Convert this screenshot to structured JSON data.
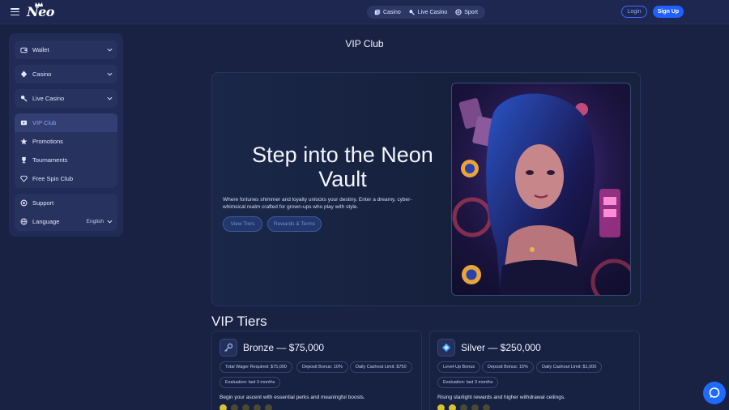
{
  "header": {
    "logo_text": "Neo",
    "nav": [
      {
        "label": "Casino",
        "icon": "casino-icon"
      },
      {
        "label": "Live Casino",
        "icon": "live-casino-icon"
      },
      {
        "label": "Sport",
        "icon": "sport-icon"
      }
    ],
    "login_label": "Login",
    "signup_label": "Sign Up"
  },
  "sidebar": {
    "groups": [
      [
        {
          "label": "Wallet",
          "icon": "wallet-icon"
        }
      ],
      [
        {
          "label": "Casino",
          "icon": "casino-icon"
        }
      ],
      [
        {
          "label": "Live Casino",
          "icon": "live-casino-icon"
        }
      ],
      [
        {
          "label": "VIP Club",
          "icon": "vip-icon",
          "active": true
        },
        {
          "label": "Promotions",
          "icon": "promotions-icon"
        },
        {
          "label": "Tournaments",
          "icon": "trophy-icon"
        },
        {
          "label": "Free Spin Club",
          "icon": "diamond-icon"
        }
      ],
      [
        {
          "label": "Support",
          "icon": "support-icon"
        },
        {
          "label": "Language",
          "icon": "globe-icon",
          "value": "English"
        }
      ]
    ]
  },
  "main": {
    "page_title": "VIP Club",
    "hero": {
      "title": "Step into the Neon Vault",
      "description": "Where fortunes shimmer and loyalty unlocks your destiny. Enter a dreamy, cyber-whimsical realm crafted for grown-ups who play with style.",
      "button_primary": "View Tiers",
      "button_secondary": "Rewards & Terms"
    },
    "tiers_title": "VIP Tiers",
    "tiers": [
      {
        "name": "Bronze — $75,000",
        "icon": "key-icon",
        "chips": [
          "Total Wager Required: $75,000",
          "Deposit Bonus: 10%",
          "Daily Cashout Limit: $750",
          "Evaluation: last 3 months"
        ],
        "description": "Begin your ascent with essential perks and meaningful boosts.",
        "level": 1,
        "max_level": 5
      },
      {
        "name": "Silver — $250,000",
        "icon": "gem-icon",
        "chips": [
          "Level-Up Bonus",
          "Deposit Bonus: 15%",
          "Daily Cashout Limit: $1,000",
          "Evaluation: last 3 months"
        ],
        "description": "Rising starlight rewards and higher withdrawal ceilings.",
        "level": 2,
        "max_level": 5
      }
    ]
  },
  "colors": {
    "accent": "#2160ff",
    "active_text": "#8aa2ff",
    "gold": "#d8c22f"
  }
}
